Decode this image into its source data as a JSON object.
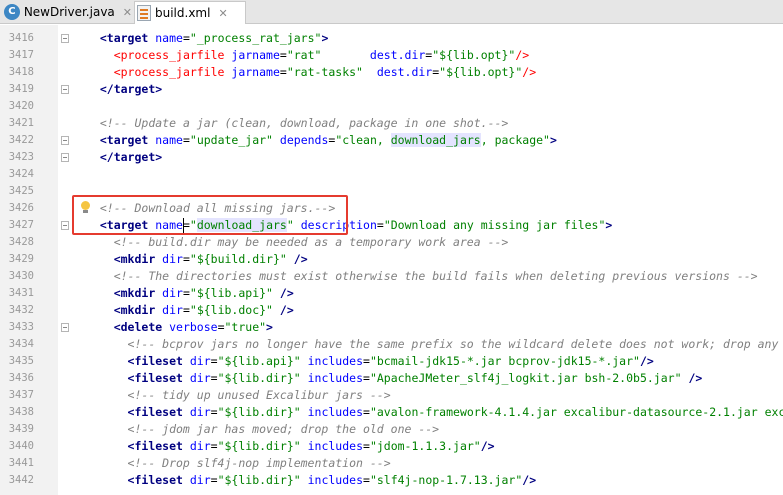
{
  "tabs": [
    {
      "label": "NewDriver.java",
      "icon": "java-class-icon",
      "active": false
    },
    {
      "label": "build.xml",
      "icon": "xml-file-icon",
      "active": true
    }
  ],
  "editor": {
    "lines": [
      {
        "num": "3416",
        "tokens": [
          [
            "i",
            "  "
          ],
          [
            "tg",
            "<target "
          ],
          [
            "at",
            "name"
          ],
          [
            "eq",
            "="
          ],
          [
            "val",
            "\"_process_rat_jars\""
          ],
          [
            "tg",
            ">"
          ]
        ]
      },
      {
        "num": "3417",
        "tokens": [
          [
            "i",
            "    "
          ],
          [
            "red",
            "<process_jarfile "
          ],
          [
            "at",
            "jarname"
          ],
          [
            "eq",
            "="
          ],
          [
            "val",
            "\"rat\""
          ],
          [
            "i",
            "       "
          ],
          [
            "at",
            "dest.dir"
          ],
          [
            "eq",
            "="
          ],
          [
            "val",
            "\"${lib.opt}\""
          ],
          [
            "red",
            "/>"
          ]
        ]
      },
      {
        "num": "3418",
        "tokens": [
          [
            "i",
            "    "
          ],
          [
            "red",
            "<process_jarfile "
          ],
          [
            "at",
            "jarname"
          ],
          [
            "eq",
            "="
          ],
          [
            "val",
            "\"rat-tasks\""
          ],
          [
            "i",
            "  "
          ],
          [
            "at",
            "dest.dir"
          ],
          [
            "eq",
            "="
          ],
          [
            "val",
            "\"${lib.opt}\""
          ],
          [
            "red",
            "/>"
          ]
        ]
      },
      {
        "num": "3419",
        "tokens": [
          [
            "i",
            "  "
          ],
          [
            "tg",
            "</target>"
          ]
        ]
      },
      {
        "num": "3420",
        "tokens": []
      },
      {
        "num": "3421",
        "tokens": [
          [
            "i",
            "  "
          ],
          [
            "cm",
            "<!-- Update a jar (clean, download, package in one shot.-->"
          ]
        ]
      },
      {
        "num": "3422",
        "tokens": [
          [
            "i",
            "  "
          ],
          [
            "tg",
            "<target "
          ],
          [
            "at",
            "name"
          ],
          [
            "eq",
            "="
          ],
          [
            "val",
            "\"update_jar\""
          ],
          [
            "i",
            " "
          ],
          [
            "at",
            "depends"
          ],
          [
            "eq",
            "="
          ],
          [
            "val",
            "\"clean, "
          ],
          [
            "valhl",
            "download_jars"
          ],
          [
            "val",
            ", package\""
          ],
          [
            "tg",
            ">"
          ]
        ]
      },
      {
        "num": "3423",
        "tokens": [
          [
            "i",
            "  "
          ],
          [
            "tg",
            "</target>"
          ]
        ]
      },
      {
        "num": "3424",
        "tokens": []
      },
      {
        "num": "3425",
        "tokens": []
      },
      {
        "num": "3426",
        "tokens": [
          [
            "i",
            "  "
          ],
          [
            "cm",
            "<!-- Download all missing jars.-->"
          ]
        ]
      },
      {
        "num": "3427",
        "tokens": [
          [
            "i",
            "  "
          ],
          [
            "tg",
            "<target "
          ],
          [
            "at",
            "name"
          ],
          [
            "eq",
            "="
          ],
          [
            "val",
            "\""
          ],
          [
            "valhl",
            "download_jars"
          ],
          [
            "val",
            "\""
          ],
          [
            "i",
            " "
          ],
          [
            "at",
            "description"
          ],
          [
            "eq",
            "="
          ],
          [
            "val",
            "\"Download any missing jar files\""
          ],
          [
            "tg",
            ">"
          ]
        ]
      },
      {
        "num": "3428",
        "tokens": [
          [
            "i",
            "    "
          ],
          [
            "cm",
            "<!-- build.dir may be needed as a temporary work area -->"
          ]
        ]
      },
      {
        "num": "3429",
        "tokens": [
          [
            "i",
            "    "
          ],
          [
            "tg",
            "<mkdir "
          ],
          [
            "at",
            "dir"
          ],
          [
            "eq",
            "="
          ],
          [
            "val",
            "\"${build.dir}\""
          ],
          [
            "i",
            " "
          ],
          [
            "tg",
            "/>"
          ]
        ]
      },
      {
        "num": "3430",
        "tokens": [
          [
            "i",
            "    "
          ],
          [
            "cm",
            "<!-- The directories must exist otherwise the build fails when deleting previous versions -->"
          ]
        ]
      },
      {
        "num": "3431",
        "tokens": [
          [
            "i",
            "    "
          ],
          [
            "tg",
            "<mkdir "
          ],
          [
            "at",
            "dir"
          ],
          [
            "eq",
            "="
          ],
          [
            "val",
            "\"${lib.api}\""
          ],
          [
            "i",
            " "
          ],
          [
            "tg",
            "/>"
          ]
        ]
      },
      {
        "num": "3432",
        "tokens": [
          [
            "i",
            "    "
          ],
          [
            "tg",
            "<mkdir "
          ],
          [
            "at",
            "dir"
          ],
          [
            "eq",
            "="
          ],
          [
            "val",
            "\"${lib.doc}\""
          ],
          [
            "i",
            " "
          ],
          [
            "tg",
            "/>"
          ]
        ]
      },
      {
        "num": "3433",
        "tokens": [
          [
            "i",
            "    "
          ],
          [
            "tg",
            "<delete "
          ],
          [
            "at",
            "verbose"
          ],
          [
            "eq",
            "="
          ],
          [
            "val",
            "\"true\""
          ],
          [
            "tg",
            ">"
          ]
        ]
      },
      {
        "num": "3434",
        "tokens": [
          [
            "i",
            "      "
          ],
          [
            "cm",
            "<!-- bcprov jars no longer have the same prefix so the wildcard delete does not work; drop any o"
          ]
        ]
      },
      {
        "num": "3435",
        "tokens": [
          [
            "i",
            "      "
          ],
          [
            "tg",
            "<fileset "
          ],
          [
            "at",
            "dir"
          ],
          [
            "eq",
            "="
          ],
          [
            "val",
            "\"${lib.api}\""
          ],
          [
            "i",
            " "
          ],
          [
            "at",
            "includes"
          ],
          [
            "eq",
            "="
          ],
          [
            "val",
            "\"bcmail-jdk15-*.jar bcprov-jdk15-*.jar\""
          ],
          [
            "tg",
            "/>"
          ]
        ]
      },
      {
        "num": "3436",
        "tokens": [
          [
            "i",
            "      "
          ],
          [
            "tg",
            "<fileset "
          ],
          [
            "at",
            "dir"
          ],
          [
            "eq",
            "="
          ],
          [
            "val",
            "\"${lib.dir}\""
          ],
          [
            "i",
            " "
          ],
          [
            "at",
            "includes"
          ],
          [
            "eq",
            "="
          ],
          [
            "val",
            "\"ApacheJMeter_slf4j_logkit.jar bsh-2.0b5.jar\""
          ],
          [
            "i",
            " "
          ],
          [
            "tg",
            "/>"
          ]
        ]
      },
      {
        "num": "3437",
        "tokens": [
          [
            "i",
            "      "
          ],
          [
            "cm",
            "<!-- tidy up unused Excalibur jars -->"
          ]
        ]
      },
      {
        "num": "3438",
        "tokens": [
          [
            "i",
            "      "
          ],
          [
            "tg",
            "<fileset "
          ],
          [
            "at",
            "dir"
          ],
          [
            "eq",
            "="
          ],
          [
            "val",
            "\"${lib.dir}\""
          ],
          [
            "i",
            " "
          ],
          [
            "at",
            "includes"
          ],
          [
            "eq",
            "="
          ],
          [
            "val",
            "\"avalon-framework-4.1.4.jar excalibur-datasource-2.1.jar exca"
          ]
        ]
      },
      {
        "num": "3439",
        "tokens": [
          [
            "i",
            "      "
          ],
          [
            "cm",
            "<!-- jdom jar has moved; drop the old one -->"
          ]
        ]
      },
      {
        "num": "3440",
        "tokens": [
          [
            "i",
            "      "
          ],
          [
            "tg",
            "<fileset "
          ],
          [
            "at",
            "dir"
          ],
          [
            "eq",
            "="
          ],
          [
            "val",
            "\"${lib.dir}\""
          ],
          [
            "i",
            " "
          ],
          [
            "at",
            "includes"
          ],
          [
            "eq",
            "="
          ],
          [
            "val",
            "\"jdom-1.1.3.jar\""
          ],
          [
            "tg",
            "/>"
          ]
        ]
      },
      {
        "num": "3441",
        "tokens": [
          [
            "i",
            "      "
          ],
          [
            "cm",
            "<!-- Drop slf4j-nop implementation -->"
          ]
        ]
      },
      {
        "num": "3442",
        "tokens": [
          [
            "i",
            "      "
          ],
          [
            "tg",
            "<fileset "
          ],
          [
            "at",
            "dir"
          ],
          [
            "eq",
            "="
          ],
          [
            "val",
            "\"${lib.dir}\""
          ],
          [
            "i",
            " "
          ],
          [
            "at",
            "includes"
          ],
          [
            "eq",
            "="
          ],
          [
            "val",
            "\"slf4j-nop-1.7.13.jar\""
          ],
          [
            "tg",
            "/>"
          ]
        ]
      }
    ]
  },
  "annotation": {
    "label": "red-highlight-box"
  }
}
